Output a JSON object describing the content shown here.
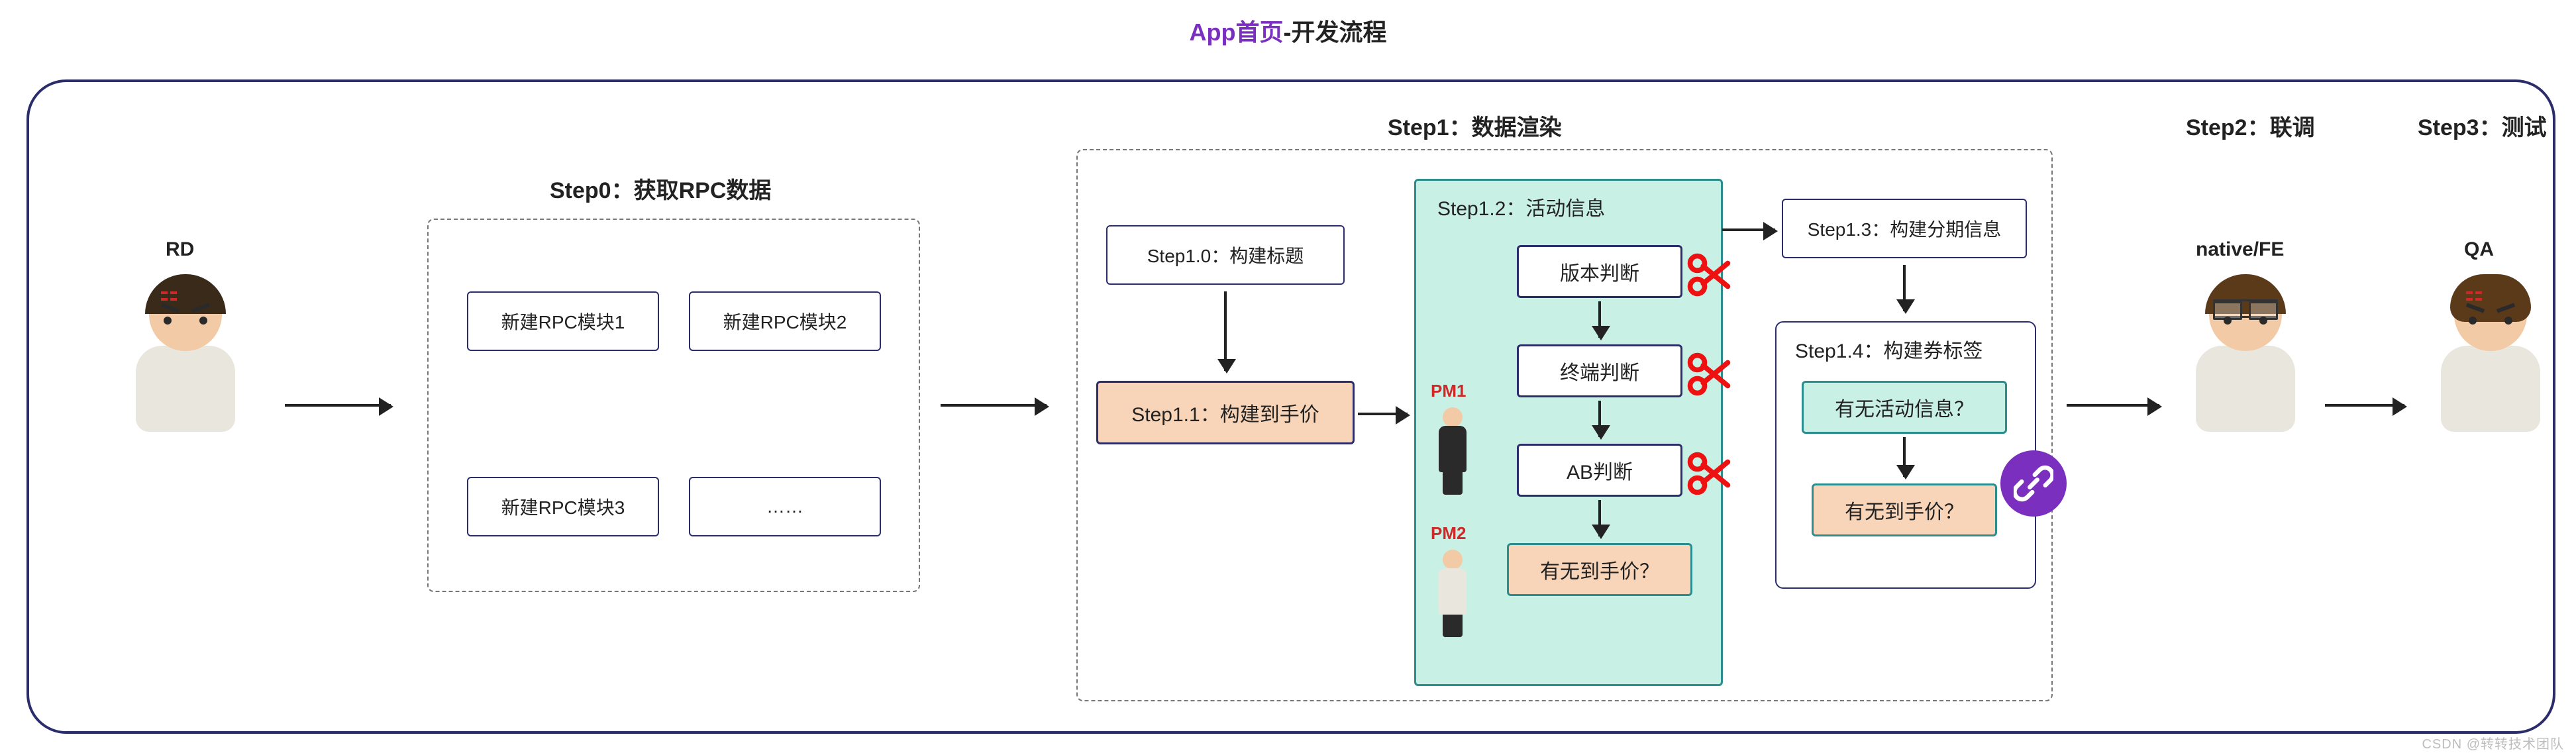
{
  "title": {
    "prefix": "App首页",
    "suffix": "-开发流程"
  },
  "roles": {
    "rd": "RD",
    "native_fe": "native/FE",
    "qa": "QA"
  },
  "step0": {
    "title": "Step0：获取RPC数据",
    "modules": [
      "新建RPC模块1",
      "新建RPC模块2",
      "新建RPC模块3",
      "……"
    ]
  },
  "step1": {
    "title": "Step1：数据渲染",
    "s10": "Step1.0：构建标题",
    "s11": "Step1.1：构建到手价",
    "s12": {
      "title": "Step1.2：活动信息",
      "n1": "版本判断",
      "n2": "终端判断",
      "n3": "AB判断",
      "n4": "有无到手价？",
      "pm1": "PM1",
      "pm2": "PM2"
    },
    "s13": "Step1.3：构建分期信息",
    "s14": {
      "title": "Step1.4：构建券标签",
      "q1": "有无活动信息？",
      "q2": "有无到手价？"
    }
  },
  "step2": {
    "title": "Step2：联调"
  },
  "step3": {
    "title": "Step3：测试"
  },
  "watermark": "CSDN @转转技术团队"
}
